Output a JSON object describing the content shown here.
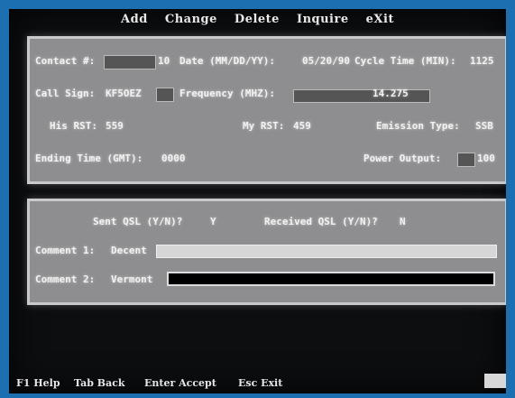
{
  "menu": [
    "Add",
    "Change",
    "Delete",
    "Inquire",
    "eXit"
  ],
  "record": {
    "contact_label": "Contact #:",
    "contact_value": "10",
    "date_label": "Date (MM/DD/YY):",
    "date_value": "05/20/90",
    "cycle_label": "Cycle Time (MIN):",
    "cycle_value": "1125",
    "call_sign_label": "Call Sign:",
    "call_sign_value": "KF5OEZ",
    "frequency_label": "Frequency (MHZ):",
    "frequency_value": "14.275",
    "his_rst_label": "His RST:",
    "his_rst_value": "559",
    "my_rst_label": "My RST:",
    "my_rst_value": "459",
    "emission_label": "Emission Type:",
    "emission_value": "SSB",
    "ending_label": "Ending Time (GMT):",
    "ending_value": "0000",
    "power_label": "Power Output:",
    "power_value": "100"
  },
  "qsl": {
    "sent_label": "Sent QSL (Y/N)?",
    "sent_value": "Y",
    "received_label": "Received QSL (Y/N)?",
    "received_value": "N",
    "comment1_label": "Comment 1:",
    "comment1_value": "Decent",
    "comment2_label": "Comment 2:",
    "comment2_value": "Vermont"
  },
  "status": {
    "f1": "F1 Help",
    "tab": "Tab Back",
    "enter": "Enter Accept",
    "esc": "Esc Exit"
  }
}
